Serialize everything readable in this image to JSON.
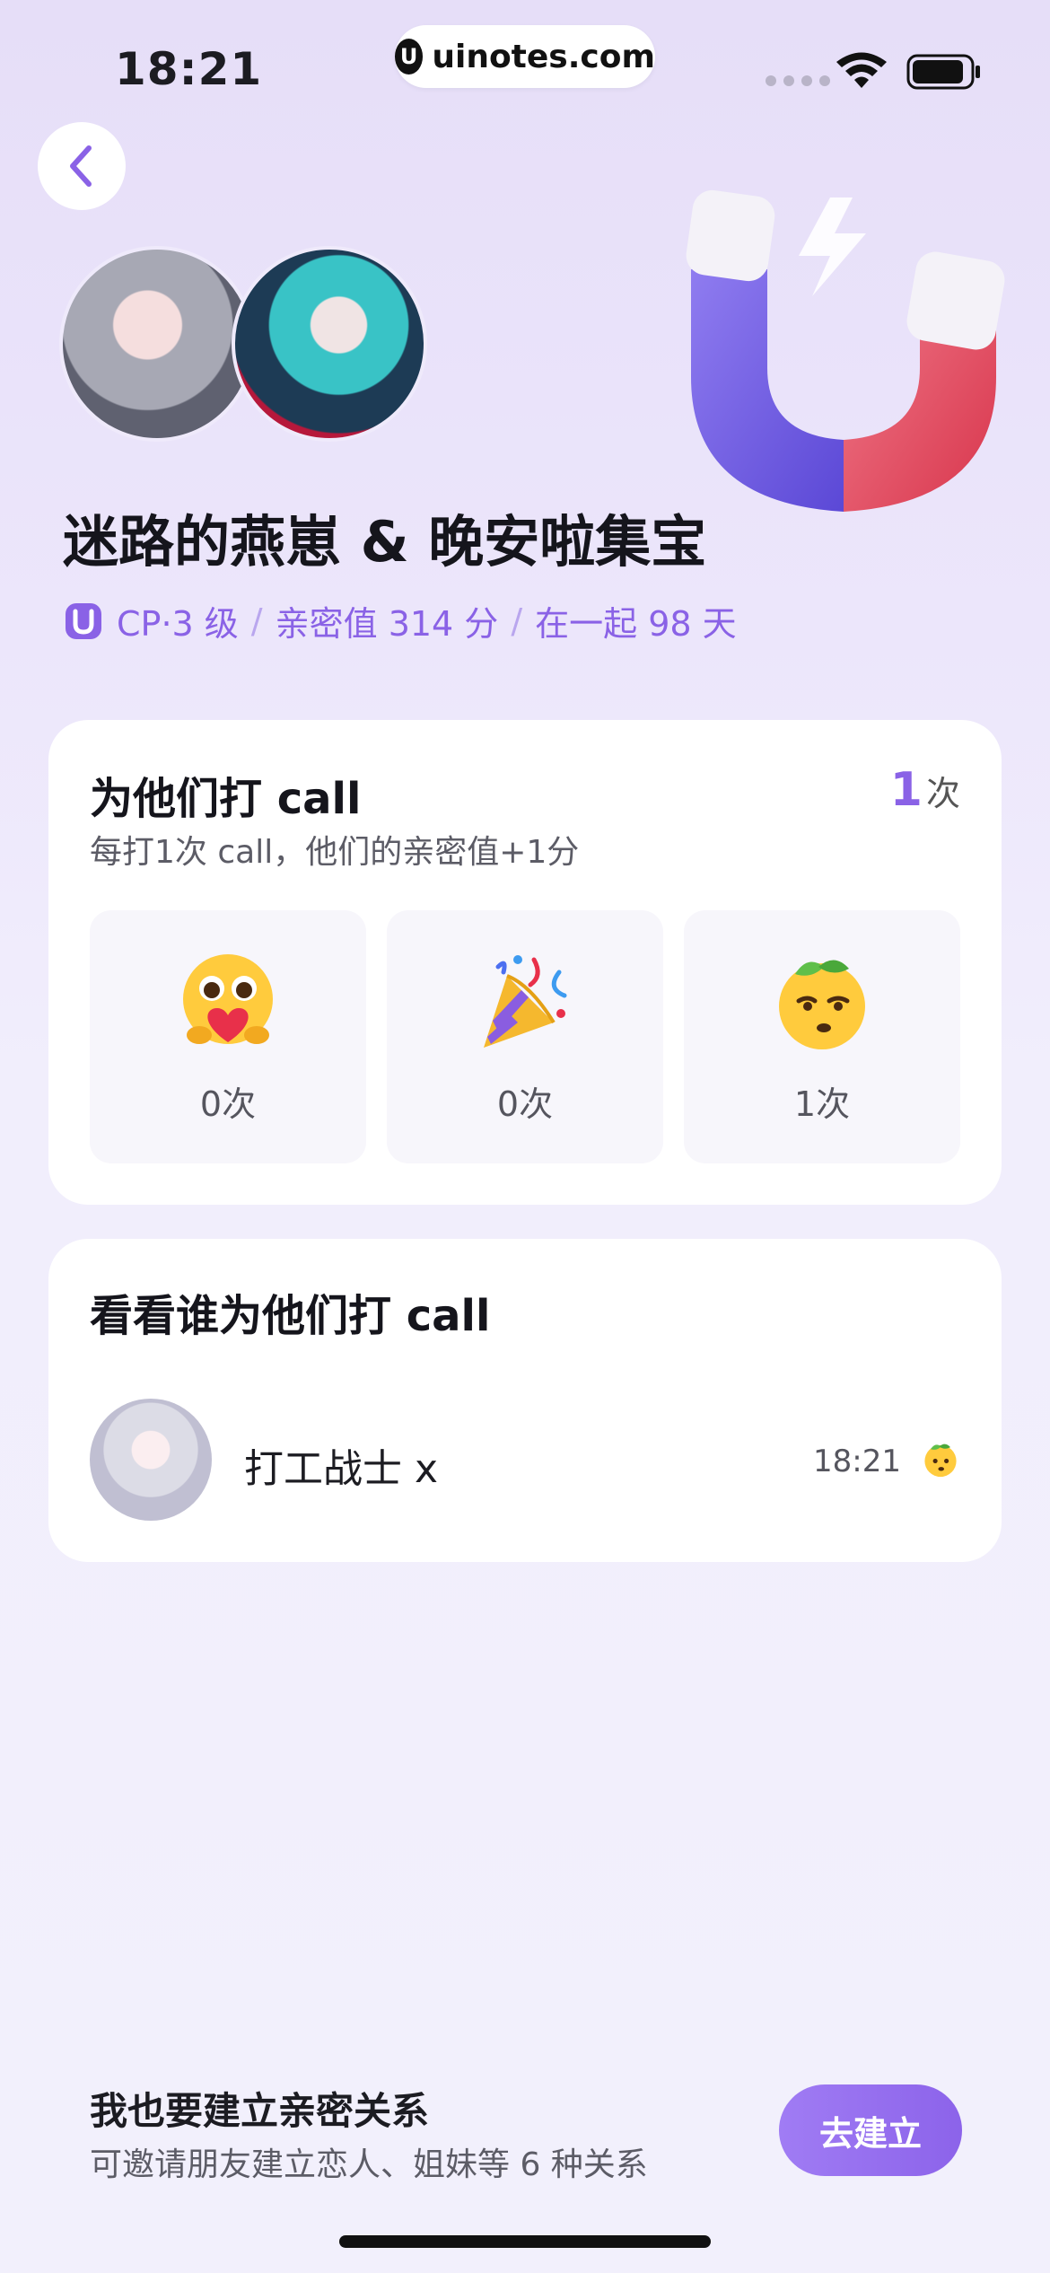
{
  "status_bar": {
    "time": "18:21",
    "watermark": "uinotes.com"
  },
  "header": {
    "couple_title": "迷路的燕崽 & 晚安啦集宝",
    "cp_level": "CP·3 级",
    "intimacy": "亲密值 314 分",
    "days_together": "在一起 98 天",
    "separator": "/"
  },
  "cheer_card": {
    "title": "为他们打 call",
    "count_value": "1",
    "count_unit": "次",
    "subtitle": "每打1次 call，他们的亲密值+1分",
    "options": [
      {
        "icon": "hug-face-icon",
        "count": "0次"
      },
      {
        "icon": "party-popper-icon",
        "count": "0次"
      },
      {
        "icon": "lemon-face-icon",
        "count": "1次"
      }
    ]
  },
  "who_card": {
    "title": "看看谁为他们打 call",
    "entries": [
      {
        "name": "打工战士 x",
        "time": "18:21",
        "icon": "lemon-face-icon"
      }
    ]
  },
  "bottom_bar": {
    "title": "我也要建立亲密关系",
    "subtitle": "可邀请朋友建立恋人、姐妹等 6 种关系",
    "button_label": "去建立"
  },
  "colors": {
    "accent": "#8a62e6",
    "background": "#ece6fb",
    "card": "#ffffff"
  }
}
